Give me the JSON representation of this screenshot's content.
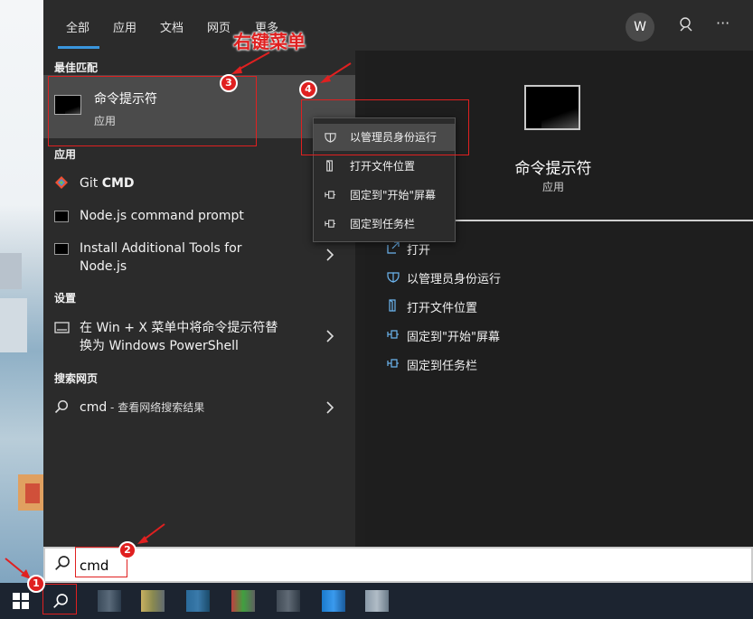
{
  "tabs": [
    "全部",
    "应用",
    "文档",
    "网页",
    "更多"
  ],
  "user_initial": "W",
  "sections": {
    "best_match": "最佳匹配",
    "apps": "应用",
    "settings": "设置",
    "web": "搜索网页"
  },
  "best_match": {
    "title": "命令提示符",
    "subtitle": "应用"
  },
  "apps": [
    {
      "pre": "Git ",
      "bold": "CMD"
    },
    {
      "text": "Node.js command prompt"
    },
    {
      "line1": "Install Additional Tools for",
      "line2": "Node.js"
    }
  ],
  "settings_item": {
    "line1": "在 Win + X 菜单中将命令提示符替",
    "line2": "换为 Windows PowerShell"
  },
  "web_item": {
    "query": "cmd",
    "suffix": " - 查看网络搜索结果"
  },
  "context_menu": [
    "以管理员身份运行",
    "打开文件位置",
    "固定到\"开始\"屏幕",
    "固定到任务栏"
  ],
  "preview": {
    "title": "命令提示符",
    "subtitle": "应用",
    "actions": [
      "打开",
      "以管理员身份运行",
      "打开文件位置",
      "固定到\"开始\"屏幕",
      "固定到任务栏"
    ]
  },
  "search": {
    "value": "cmd"
  },
  "annotations": {
    "label": "右键菜单",
    "badges": [
      "1",
      "2",
      "3",
      "4"
    ]
  },
  "colors": {
    "accent": "#3a96dd",
    "annotation": "#e02020",
    "menu_bg": "#2b2b2b"
  },
  "icons": {
    "search": "search-icon",
    "chevron": "chevron-right-icon",
    "git": "git-icon",
    "shield": "shield-icon",
    "folder": "folder-icon",
    "pin": "pin-icon"
  }
}
